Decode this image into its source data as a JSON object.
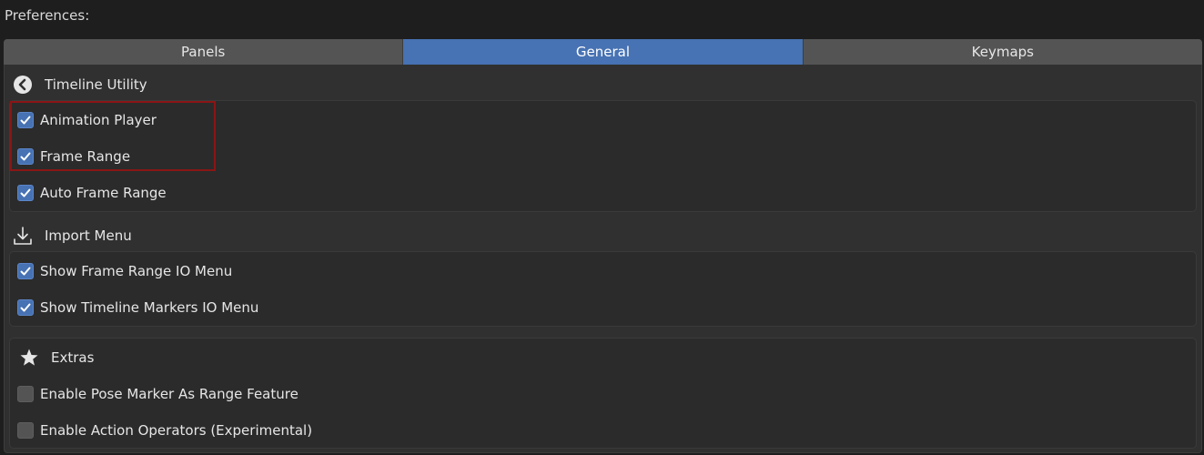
{
  "header": {
    "title": "Preferences:"
  },
  "tabs": [
    {
      "label": "Panels",
      "active": false
    },
    {
      "label": "General",
      "active": true
    },
    {
      "label": "Keymaps",
      "active": false
    }
  ],
  "sections": {
    "timeline_utility": {
      "title": "Timeline Utility",
      "icon": "chevron-left-circle-icon",
      "options": [
        {
          "label": "Animation Player",
          "checked": true
        },
        {
          "label": "Frame Range",
          "checked": true
        },
        {
          "label": "Auto Frame Range",
          "checked": true
        }
      ]
    },
    "import_menu": {
      "title": "Import Menu",
      "icon": "import-arrow-icon",
      "options": [
        {
          "label": "Show Frame Range IO Menu",
          "checked": true
        },
        {
          "label": "Show Timeline Markers IO Menu",
          "checked": true
        }
      ]
    },
    "extras": {
      "title": "Extras",
      "icon": "star-icon",
      "options": [
        {
          "label": "Enable Pose Marker As Range Feature",
          "checked": false
        },
        {
          "label": "Enable Action Operators (Experimental)",
          "checked": false
        }
      ]
    }
  },
  "colors": {
    "accent": "#4772b3",
    "highlight": "#8b1515",
    "background": "#1e1e1e",
    "panel": "#303030"
  }
}
